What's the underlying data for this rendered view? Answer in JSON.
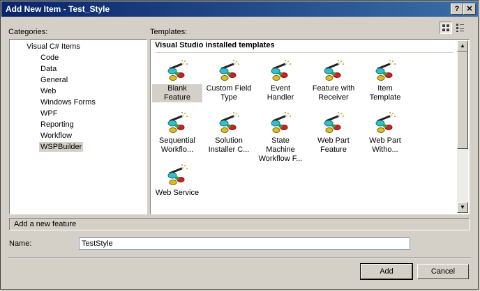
{
  "window": {
    "title": "Add New Item - Test_Style",
    "help_glyph": "?",
    "close_glyph": "✕"
  },
  "labels": {
    "categories": "Categories:",
    "templates": "Templates:",
    "name": "Name:"
  },
  "categories": {
    "root": "Visual C# Items",
    "items": [
      "Code",
      "Data",
      "General",
      "Web",
      "Windows Forms",
      "WPF",
      "Reporting",
      "Workflow",
      "WSPBuilder"
    ],
    "selected": "WSPBuilder"
  },
  "templates": {
    "header": "Visual Studio installed templates",
    "items": [
      {
        "line1": "Blank Feature",
        "line2": ""
      },
      {
        "line1": "Custom Field",
        "line2": "Type"
      },
      {
        "line1": "Event Handler",
        "line2": ""
      },
      {
        "line1": "Feature with",
        "line2": "Receiver"
      },
      {
        "line1": "Item Template",
        "line2": ""
      },
      {
        "line1": "Sequential",
        "line2": "Workflo..."
      },
      {
        "line1": "Solution",
        "line2": "Installer C..."
      },
      {
        "line1": "State Machine",
        "line2": "Workflow F..."
      },
      {
        "line1": "Web Part",
        "line2": "Feature"
      },
      {
        "line1": "Web Part",
        "line2": "Witho..."
      },
      {
        "line1": "Web Service",
        "line2": ""
      }
    ],
    "selected": "Blank Feature",
    "icon": "feature-wand-icon"
  },
  "description": "Add a new feature",
  "name_field": {
    "value": "TestStyle"
  },
  "buttons": {
    "add": "Add",
    "cancel": "Cancel"
  },
  "view_buttons": {
    "large_icons": "large-icons-view-icon",
    "small_icons": "list-view-icon"
  }
}
